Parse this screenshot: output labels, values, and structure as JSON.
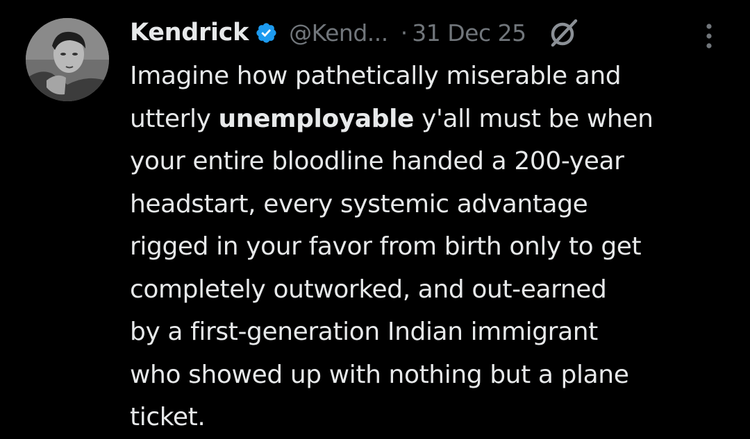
{
  "author": {
    "display_name": "Kendrick",
    "handle": "@Kend...",
    "verified": true
  },
  "meta": {
    "separator": "·",
    "date": "31 Dec 25"
  },
  "icons": {
    "verified": "verified-badge-icon",
    "grok": "grok-slash-circle-icon",
    "more": "more-vertical-icon"
  },
  "colors": {
    "background": "#000000",
    "text": "#e7e9ea",
    "muted": "#71767b",
    "verified": "#1d9bf0"
  },
  "tweet": {
    "line1": "Imagine how pathetically miserable and",
    "line2_pre": "utterly ",
    "line2_bold": "unemployable",
    "line2_post": " y'all must be when",
    "line3": "your entire bloodline handed a 200-year",
    "line4": "headstart, every systemic advantage",
    "line5": "rigged in your favor from birth only to get",
    "line6": "completely outworked, and out-earned",
    "line7": "by a first-generation Indian immigrant",
    "line8": "who showed up with nothing but a plane",
    "line9": "ticket."
  }
}
